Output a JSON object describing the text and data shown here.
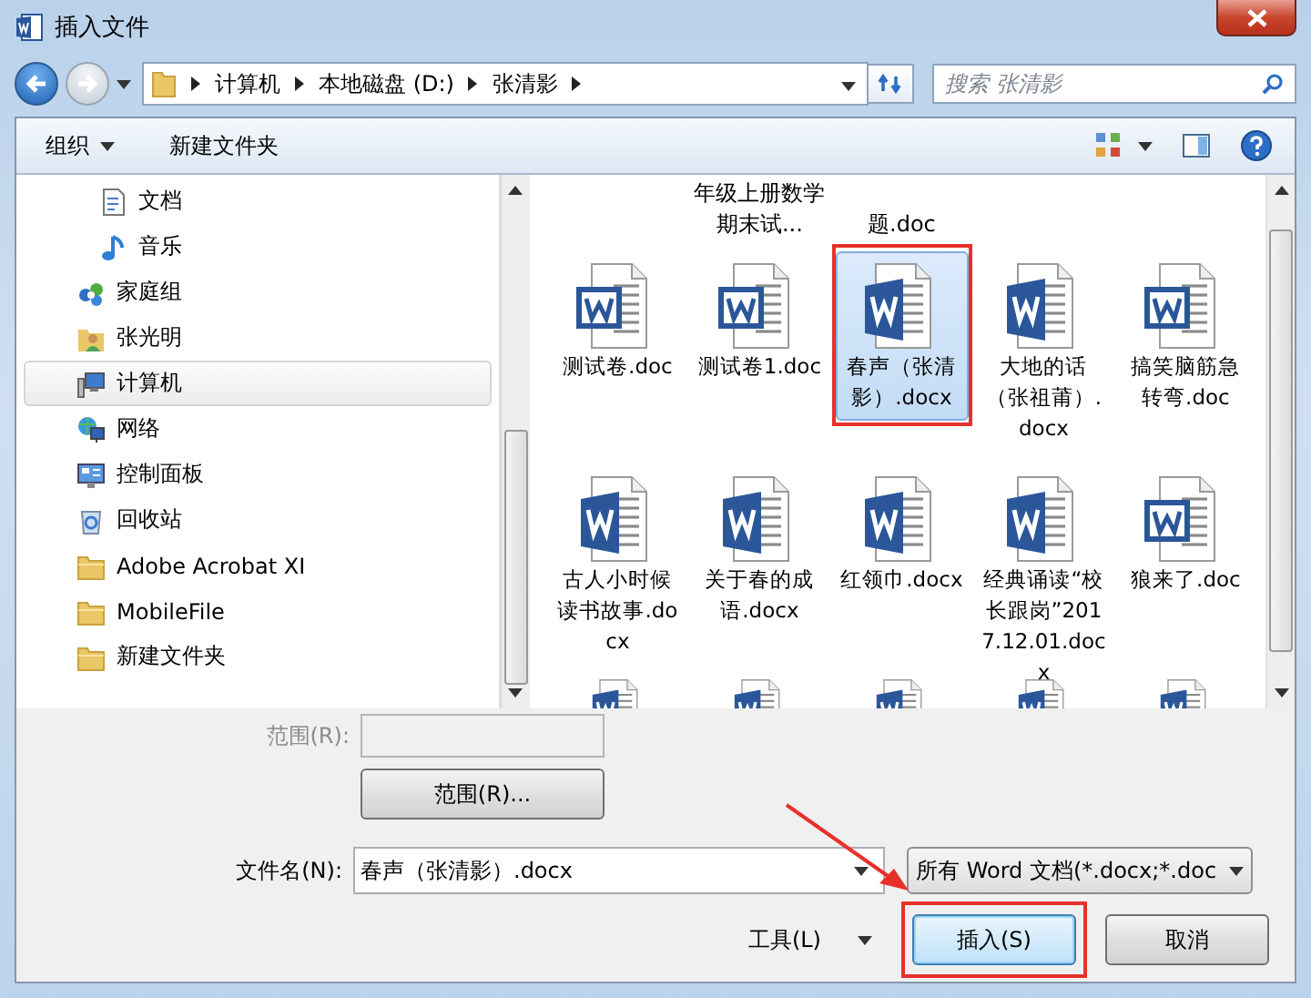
{
  "window": {
    "title": "插入文件"
  },
  "address_bar": {
    "path": [
      "计算机",
      "本地磁盘 (D:)",
      "张清影"
    ],
    "search_placeholder": "搜索 张清影"
  },
  "toolbar": {
    "organize": "组织",
    "new_folder": "新建文件夹"
  },
  "sidebar": {
    "items": [
      {
        "kind": "group",
        "children": [
          {
            "label": "文档",
            "kind": "document",
            "selected": false
          },
          {
            "label": "音乐",
            "kind": "music",
            "selected": false
          }
        ]
      },
      {
        "label": "家庭组",
        "kind": "homegroup",
        "selected": false
      },
      {
        "label": "张光明",
        "kind": "user",
        "selected": false
      },
      {
        "label": "计算机",
        "kind": "computer",
        "selected": true
      },
      {
        "label": "网络",
        "kind": "network",
        "selected": false
      },
      {
        "label": "控制面板",
        "kind": "control-panel",
        "selected": false
      },
      {
        "label": "回收站",
        "kind": "recycle-bin",
        "selected": false
      },
      {
        "label": "Adobe Acrobat XI",
        "kind": "folder",
        "selected": false
      },
      {
        "label": "MobileFile",
        "kind": "folder",
        "selected": false
      },
      {
        "label": "新建文件夹",
        "kind": "folder",
        "selected": false
      }
    ]
  },
  "files": [
    {
      "kind": "blank"
    },
    {
      "kind": "caption",
      "name": "年级上册数学期末试..."
    },
    {
      "kind": "caption",
      "name": "题.doc"
    },
    {
      "kind": "blank"
    },
    {
      "kind": "blank"
    },
    {
      "kind": "doc",
      "name": "测试卷.doc",
      "selected": false,
      "highlighted": false
    },
    {
      "kind": "doc",
      "name": "测试卷1.doc",
      "selected": false,
      "highlighted": false
    },
    {
      "kind": "docx",
      "name": "春声（张清影）.docx",
      "selected": true,
      "highlighted": true
    },
    {
      "kind": "docx",
      "name": "大地的话（张祖莆）.docx",
      "selected": false,
      "highlighted": false
    },
    {
      "kind": "doc",
      "name": "搞笑脑筋急转弯.doc",
      "selected": false,
      "highlighted": false
    },
    {
      "kind": "docx",
      "name": "古人小时候读书故事.docx",
      "selected": false,
      "highlighted": false
    },
    {
      "kind": "docx",
      "name": "关于春的成语.docx",
      "selected": false,
      "highlighted": false
    },
    {
      "kind": "docx",
      "name": "红领巾.docx",
      "selected": false,
      "highlighted": false
    },
    {
      "kind": "docx",
      "name": "经典诵读“校长跟岗”2017.12.01.docx",
      "selected": false,
      "highlighted": false
    },
    {
      "kind": "doc",
      "name": "狼来了.doc",
      "selected": false,
      "highlighted": false
    },
    {
      "kind": "stub"
    },
    {
      "kind": "stub"
    },
    {
      "kind": "stub"
    },
    {
      "kind": "stub"
    },
    {
      "kind": "stub"
    }
  ],
  "bottom": {
    "range_label": "范围(R):",
    "range_disabled": true,
    "range_button": "范围(R)...",
    "file_name_label": "文件名(N):",
    "file_name": "春声（张清影）.docx",
    "arrow_annotation": true,
    "file_type": "所有 Word 文档(*.docx;*.doc",
    "tools": "工具(L)",
    "buttons": [
      {
        "label": "插入(S)",
        "kind": "primary",
        "highlighted": true
      },
      {
        "label": "取消",
        "kind": "normal",
        "highlighted": false
      }
    ]
  }
}
